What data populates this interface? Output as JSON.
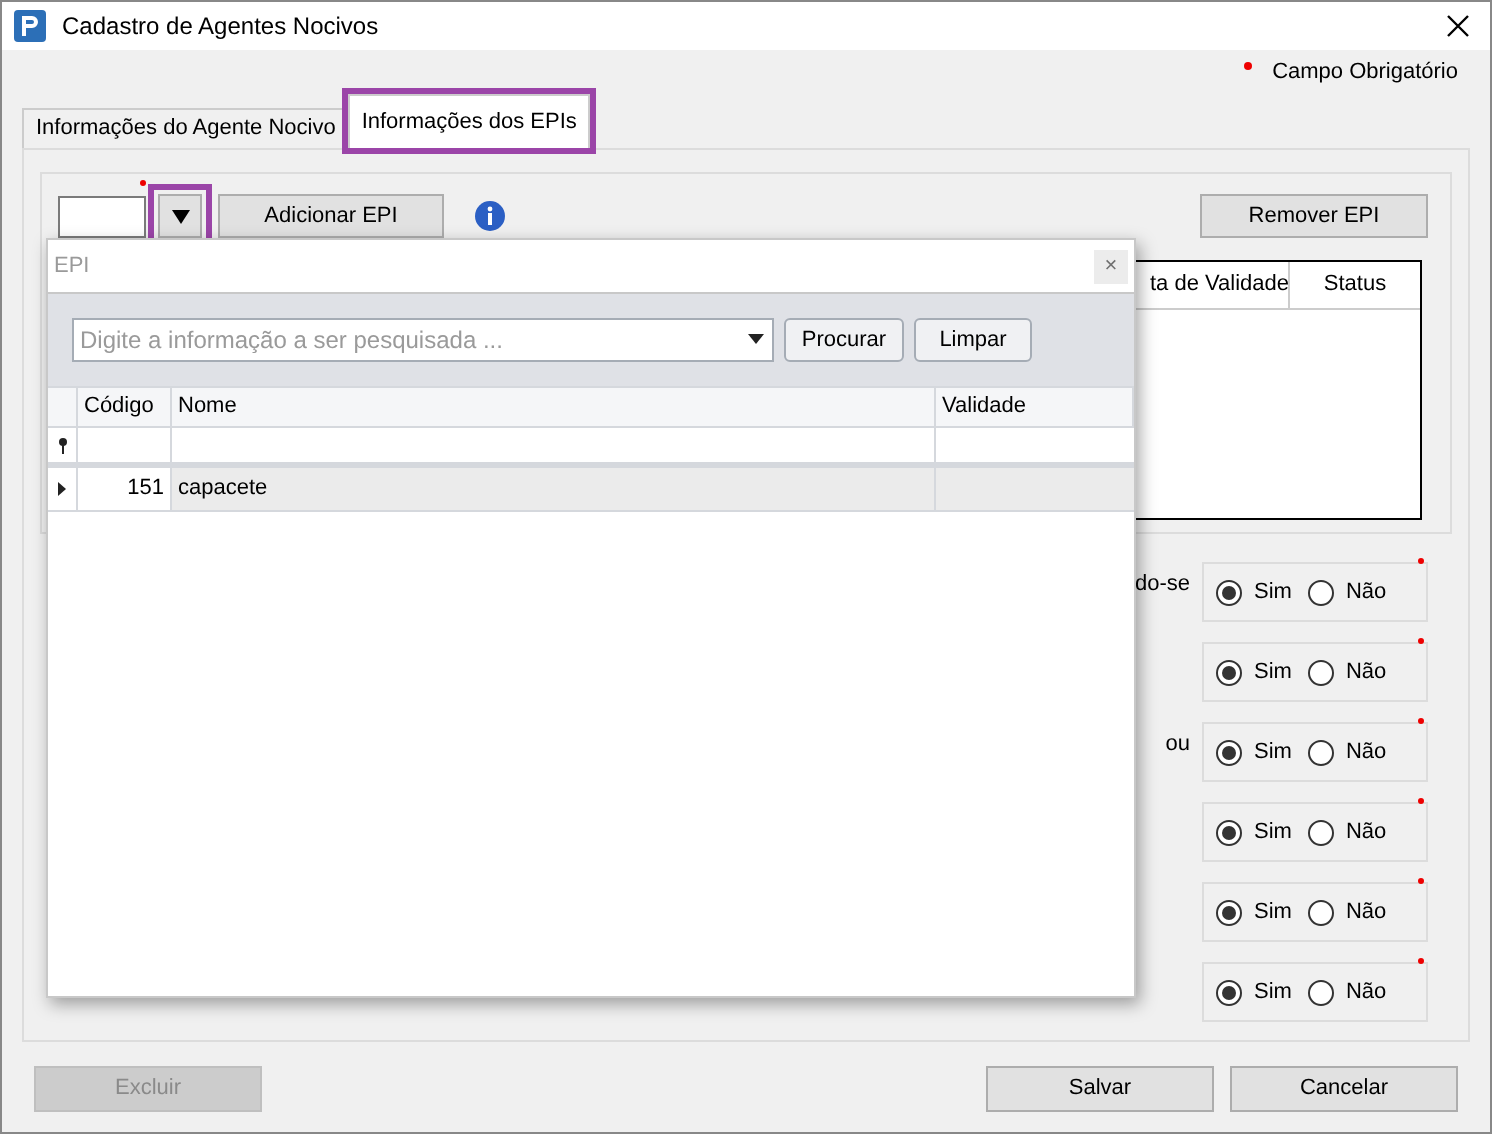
{
  "window": {
    "title": "Cadastro de Agentes Nocivos",
    "required_legend": "Campo Obrigatório"
  },
  "tabs": [
    {
      "label": "Informações do Agente Nocivo",
      "selected": false,
      "highlighted": false
    },
    {
      "label": "Informações dos EPIs",
      "selected": true,
      "highlighted": true
    }
  ],
  "epi_toolbar": {
    "dropdown_highlighted": true,
    "add_button": "Adicionar EPI",
    "remove_button": "Remover EPI"
  },
  "epi_table": {
    "columns": [
      "ta de Validade",
      "Status"
    ]
  },
  "questions": [
    {
      "label": "do-se",
      "options": [
        {
          "label": "Sim",
          "selected": true
        },
        {
          "label": "Não",
          "selected": false
        }
      ]
    },
    {
      "options": [
        {
          "label": "Sim",
          "selected": true
        },
        {
          "label": "Não",
          "selected": false
        }
      ]
    },
    {
      "label": "ou",
      "options": [
        {
          "label": "Sim",
          "selected": true
        },
        {
          "label": "Não",
          "selected": false
        }
      ]
    },
    {
      "options": [
        {
          "label": "Sim",
          "selected": true
        },
        {
          "label": "Não",
          "selected": false
        }
      ]
    },
    {
      "options": [
        {
          "label": "Sim",
          "selected": true
        },
        {
          "label": "Não",
          "selected": false
        }
      ]
    },
    {
      "options": [
        {
          "label": "Sim",
          "selected": true
        },
        {
          "label": "Não",
          "selected": false
        }
      ]
    }
  ],
  "lookup_popup": {
    "title": "EPI",
    "close": "×",
    "search": {
      "placeholder": "Digite a informação a ser pesquisada ..."
    },
    "buttons": [
      "Procurar",
      "Limpar"
    ],
    "columns": [
      "Código",
      "Nome",
      "Validade"
    ],
    "rows": [
      {
        "code": "151",
        "name": "capacete",
        "selected": true
      }
    ]
  },
  "footer": {
    "buttons": [
      {
        "label": "Excluir",
        "disabled": true
      },
      {
        "label": "Salvar",
        "disabled": false
      },
      {
        "label": "Cancelar",
        "disabled": false
      }
    ]
  }
}
